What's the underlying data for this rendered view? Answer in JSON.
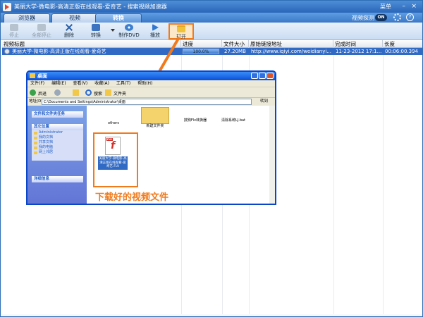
{
  "titlebar": {
    "title": "美丽大学-微电影-高清正版在线观看-爱奇艺 - 搜索视频加速器",
    "menu": "菜单",
    "minimize": "–",
    "close": "×"
  },
  "tabs": [
    {
      "label": "浏览器"
    },
    {
      "label": "视频"
    },
    {
      "label": "转换"
    }
  ],
  "header_right": {
    "sniff_label": "视频探测",
    "toggle_label": "ON",
    "help": "?"
  },
  "toolbar": {
    "stop": "停止",
    "stop_all": "全部停止",
    "delete": "删除",
    "convert": "转换",
    "make_dvd": "制作DVD",
    "play": "播放",
    "open": "打开"
  },
  "table": {
    "columns": [
      "视频标题",
      "进度",
      "文件大小",
      "原始链接地址",
      "完成时间",
      "长度"
    ],
    "rows": [
      {
        "title": "美丽大学-微电影-高清正版在线观看-爱奇艺",
        "progress": "100.0%",
        "progress_fraction": 1.0,
        "size": "27.20MB",
        "url": "http://www.iqiyi.com/weidianyi...",
        "time": "11-23-2012 17:1...",
        "length": "00:06:00.394"
      }
    ]
  },
  "explorer": {
    "title": "桌面",
    "menu": [
      "文件(F)",
      "编辑(E)",
      "查看(V)",
      "收藏(A)",
      "工具(T)",
      "帮助(H)"
    ],
    "back": "后退",
    "search": "搜索",
    "folders": "文件夹",
    "address_label": "地址(D)",
    "address": "C:\\Documents and Settings\\Administrator\\桌面",
    "go": "转到",
    "panel1_title": "文件和文件夹任务",
    "panel2_title": "其它位置",
    "panel2_items": [
      "Administrator",
      "我的文档",
      "共享文档",
      "我的电脑",
      "网上邻居"
    ],
    "panel3_title": "详细信息",
    "files": [
      "others",
      "新建文件夹",
      "搜狗Flv转换器",
      "清除系统LJ.bat"
    ],
    "flv_label": "美丽大学-微电影-高清正版在线观看-爱奇艺.FLV",
    "flv_tag": "FLV"
  },
  "callout": "下载好的视频文件",
  "colors": {
    "accent": "#f07a1c",
    "selected_row": "#316ac5",
    "title_blue": "#2a66b8"
  }
}
